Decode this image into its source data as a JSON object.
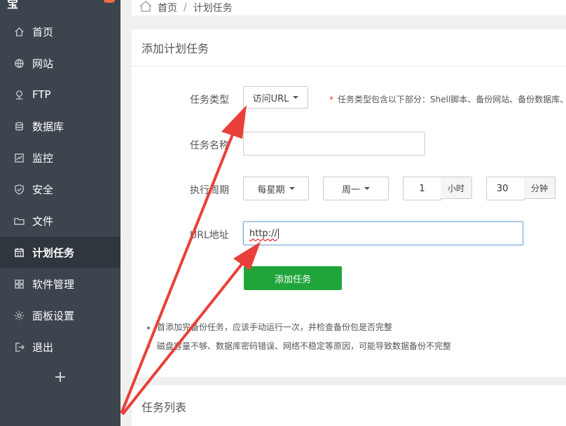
{
  "sidebar": {
    "items": [
      {
        "label": "首页",
        "icon": "home-icon",
        "active": false
      },
      {
        "label": "网站",
        "icon": "globe-icon",
        "active": false
      },
      {
        "label": "FTP",
        "icon": "ftp-icon",
        "active": false
      },
      {
        "label": "数据库",
        "icon": "database-icon",
        "active": false
      },
      {
        "label": "监控",
        "icon": "monitor-icon",
        "active": false
      },
      {
        "label": "安全",
        "icon": "shield-icon",
        "active": false
      },
      {
        "label": "文件",
        "icon": "folder-icon",
        "active": false
      },
      {
        "label": "计划任务",
        "icon": "calendar-icon",
        "active": true
      },
      {
        "label": "软件管理",
        "icon": "grid-icon",
        "active": false
      },
      {
        "label": "面板设置",
        "icon": "gear-icon",
        "active": false
      },
      {
        "label": "退出",
        "icon": "logout-icon",
        "active": false
      }
    ],
    "add_label": "+"
  },
  "breadcrumb": {
    "home": "首页",
    "separator": "/",
    "current": "计划任务"
  },
  "form": {
    "title": "添加计划任务",
    "task_type": {
      "label": "任务类型",
      "value": "访问URL",
      "hint_mark": "*",
      "hint": "任务类型包含以下部分：Shell脚本、备份网站、备份数据库、"
    },
    "task_name": {
      "label": "任务名称",
      "value": ""
    },
    "schedule": {
      "label": "执行周期",
      "period": "每星期",
      "weekday": "周一",
      "hour": "1",
      "hour_unit": "小时",
      "minute": "30",
      "minute_unit": "分钟"
    },
    "url": {
      "label": "URL地址",
      "value": "http://"
    },
    "submit_label": "添加任务"
  },
  "notes": [
    "首添加完备份任务，应该手动运行一次，并检查备份包是否完整",
    "磁盘容量不够、数据库密码错误、网络不稳定等原因，可能导致数据备份不完整"
  ],
  "task_list": {
    "title": "任务列表"
  },
  "colors": {
    "sidebar_bg": "#3c444d",
    "sidebar_active": "#2f363d",
    "primary_green": "#20a53a",
    "annotation_arrow": "#e8403a"
  }
}
